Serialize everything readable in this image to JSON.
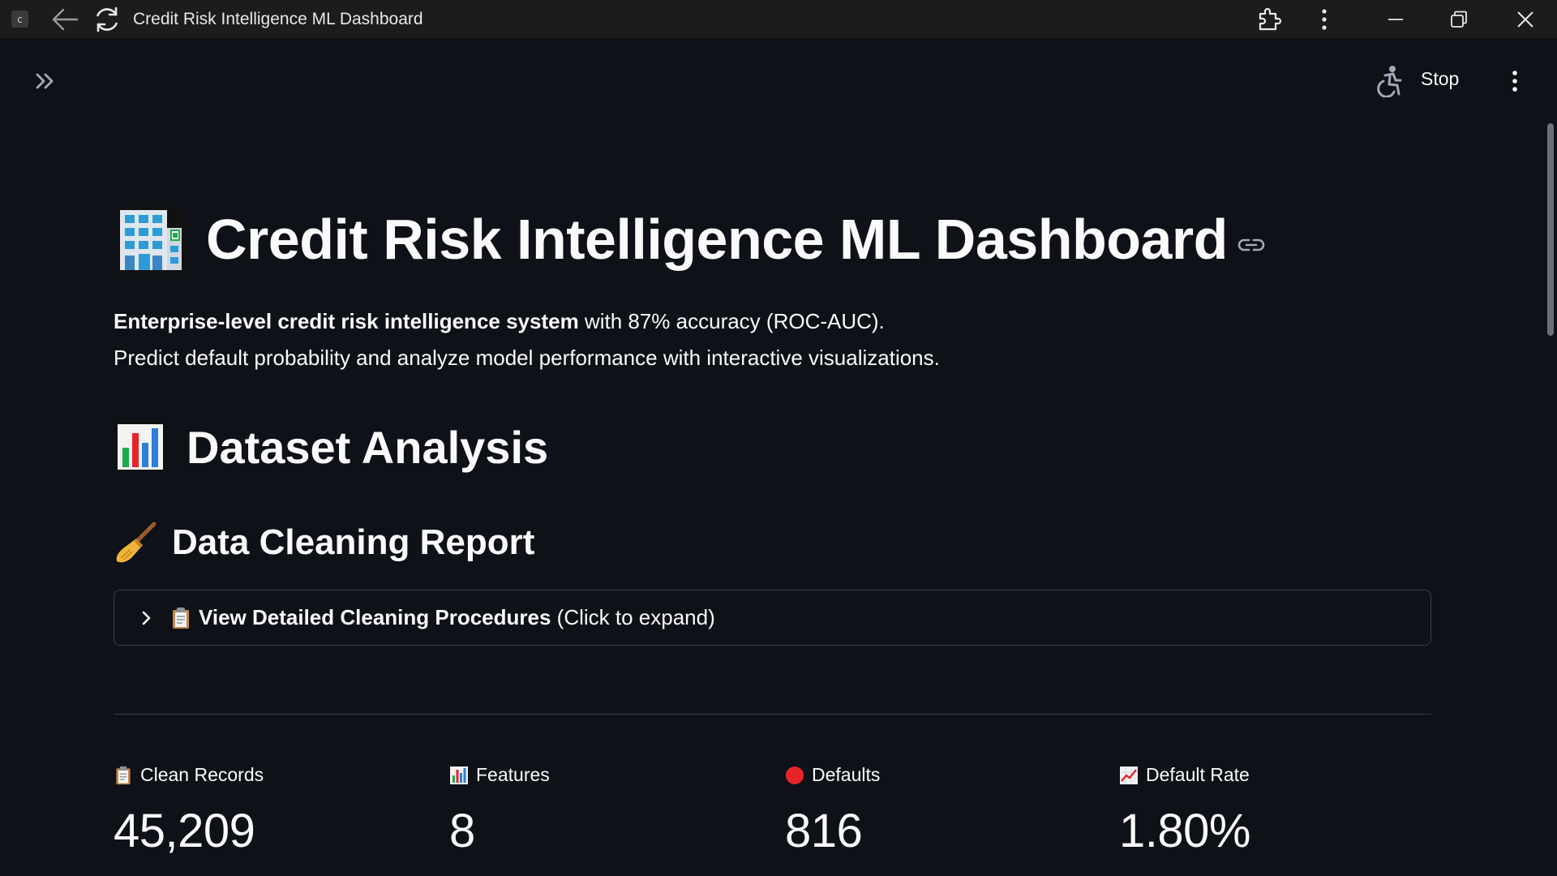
{
  "window": {
    "app_badge": "c",
    "title": "Credit Risk Intelligence ML Dashboard"
  },
  "header": {
    "stop_label": "Stop"
  },
  "page": {
    "title": "Credit Risk Intelligence ML Dashboard",
    "intro_bold": "Enterprise-level credit risk intelligence system",
    "intro_rest": " with 87% accuracy (ROC-AUC).",
    "intro_line2": "Predict default probability and analyze model performance with interactive visualizations."
  },
  "dataset_section": {
    "heading": "Dataset Analysis",
    "cleaning_heading": "Data Cleaning Report",
    "expander_bold": "View Detailed Cleaning Procedures",
    "expander_rest": " (Click to expand)"
  },
  "metrics": [
    {
      "icon": "clipboard-icon",
      "label": "Clean Records",
      "value": "45,209"
    },
    {
      "icon": "bar-chart-icon",
      "label": "Features",
      "value": "8"
    },
    {
      "icon": "red-circle-icon",
      "label": "Defaults",
      "value": "816"
    },
    {
      "icon": "chart-increasing-icon",
      "label": "Default Rate",
      "value": "1.80%"
    }
  ],
  "colors": {
    "background": "#0e1117",
    "titlebar": "#1c1c1c",
    "text": "#fafafa",
    "border": "#3a3d46",
    "red_dot": "#e8242b"
  }
}
